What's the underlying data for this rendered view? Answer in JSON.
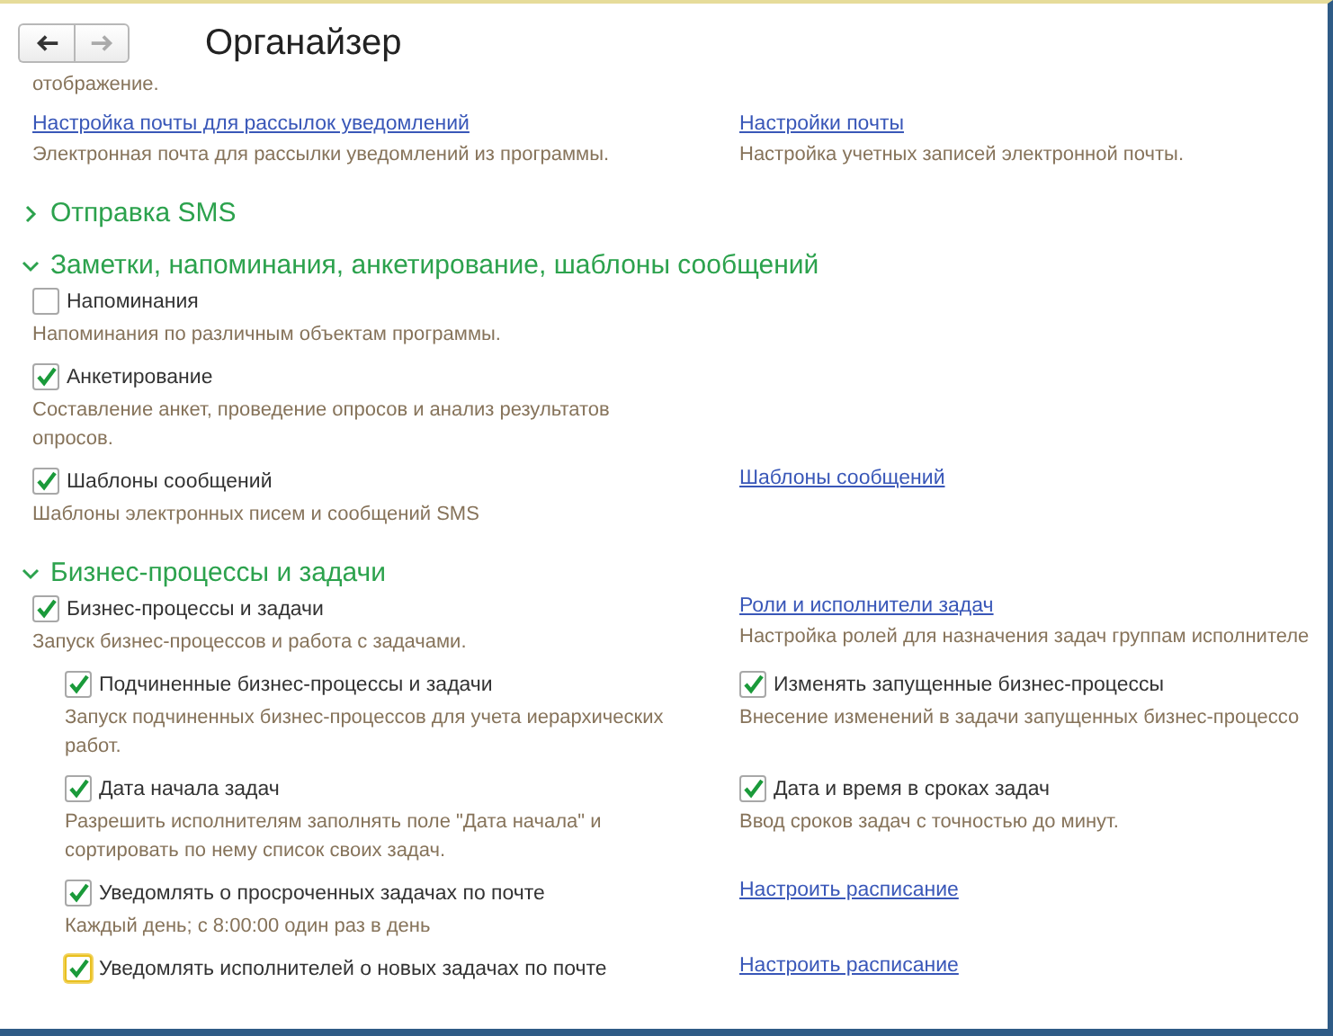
{
  "window": {
    "title": "Органайзер",
    "nav": [
      {
        "kind": "back",
        "disabled": false
      },
      {
        "kind": "forward",
        "disabled": true
      }
    ]
  },
  "blocks": [
    {
      "kind": "plain",
      "rows": [
        {
          "left": {
            "kind": "text",
            "description": "отображение."
          }
        },
        {
          "left": {
            "kind": "link",
            "label": "Настройка почты для рассылок уведомлений",
            "description": "Электронная почта для рассылки уведомлений из программы."
          },
          "right": {
            "kind": "link",
            "label": "Настройки почты",
            "description": "Настройка учетных записей электронной почты."
          }
        }
      ]
    },
    {
      "kind": "section",
      "title": "Отправка SMS",
      "expanded": false
    },
    {
      "kind": "section",
      "title": "Заметки, напоминания, анкетирование, шаблоны сообщений",
      "expanded": true,
      "rows": [
        {
          "left": {
            "kind": "checkbox",
            "label": "Напоминания",
            "checked": false,
            "description": "Напоминания по различным объектам программы."
          }
        },
        {
          "left": {
            "kind": "checkbox",
            "label": "Анкетирование",
            "checked": true,
            "description": "Составление анкет, проведение опросов и анализ результатов опросов."
          }
        },
        {
          "left": {
            "kind": "checkbox",
            "label": "Шаблоны сообщений",
            "checked": true,
            "description": "Шаблоны электронных писем и сообщений SMS"
          },
          "right": {
            "kind": "link",
            "label": "Шаблоны сообщений"
          }
        }
      ]
    },
    {
      "kind": "section",
      "title": "Бизнес-процессы и задачи",
      "expanded": true,
      "rows": [
        {
          "left": {
            "kind": "checkbox",
            "label": "Бизнес-процессы и задачи",
            "checked": true,
            "description": "Запуск бизнес-процессов и работа с задачами."
          },
          "right": {
            "kind": "link",
            "label": "Роли и исполнители задач",
            "description": "Настройка ролей для назначения задач группам исполнителе"
          },
          "children": [
            {
              "left": {
                "kind": "checkbox",
                "label": "Подчиненные бизнес-процессы и задачи",
                "checked": true,
                "description": "Запуск подчиненных бизнес-процессов для учета иерархических работ."
              },
              "right": {
                "kind": "checkbox",
                "label": "Изменять запущенные бизнес-процессы",
                "checked": true,
                "description": "Внесение изменений в задачи запущенных бизнес-процессо"
              }
            },
            {
              "left": {
                "kind": "checkbox",
                "label": "Дата начала задач",
                "checked": true,
                "description": "Разрешить исполнителям заполнять поле \"Дата начала\" и сортировать по нему список своих задач."
              },
              "right": {
                "kind": "checkbox",
                "label": "Дата и время в сроках задач",
                "checked": true,
                "description": "Ввод сроков задач с точностью до минут."
              }
            },
            {
              "left": {
                "kind": "checkbox",
                "label": "Уведомлять о просроченных задачах по почте",
                "checked": true,
                "description": "Каждый день; с 8:00:00 один раз в день"
              },
              "right": {
                "kind": "link",
                "label": "Настроить расписание"
              }
            },
            {
              "left": {
                "kind": "checkbox",
                "label": "Уведомлять исполнителей о новых задачах по почте",
                "checked": true,
                "focused": true
              },
              "right": {
                "kind": "link",
                "label": "Настроить расписание"
              }
            }
          ]
        }
      ]
    }
  ]
}
